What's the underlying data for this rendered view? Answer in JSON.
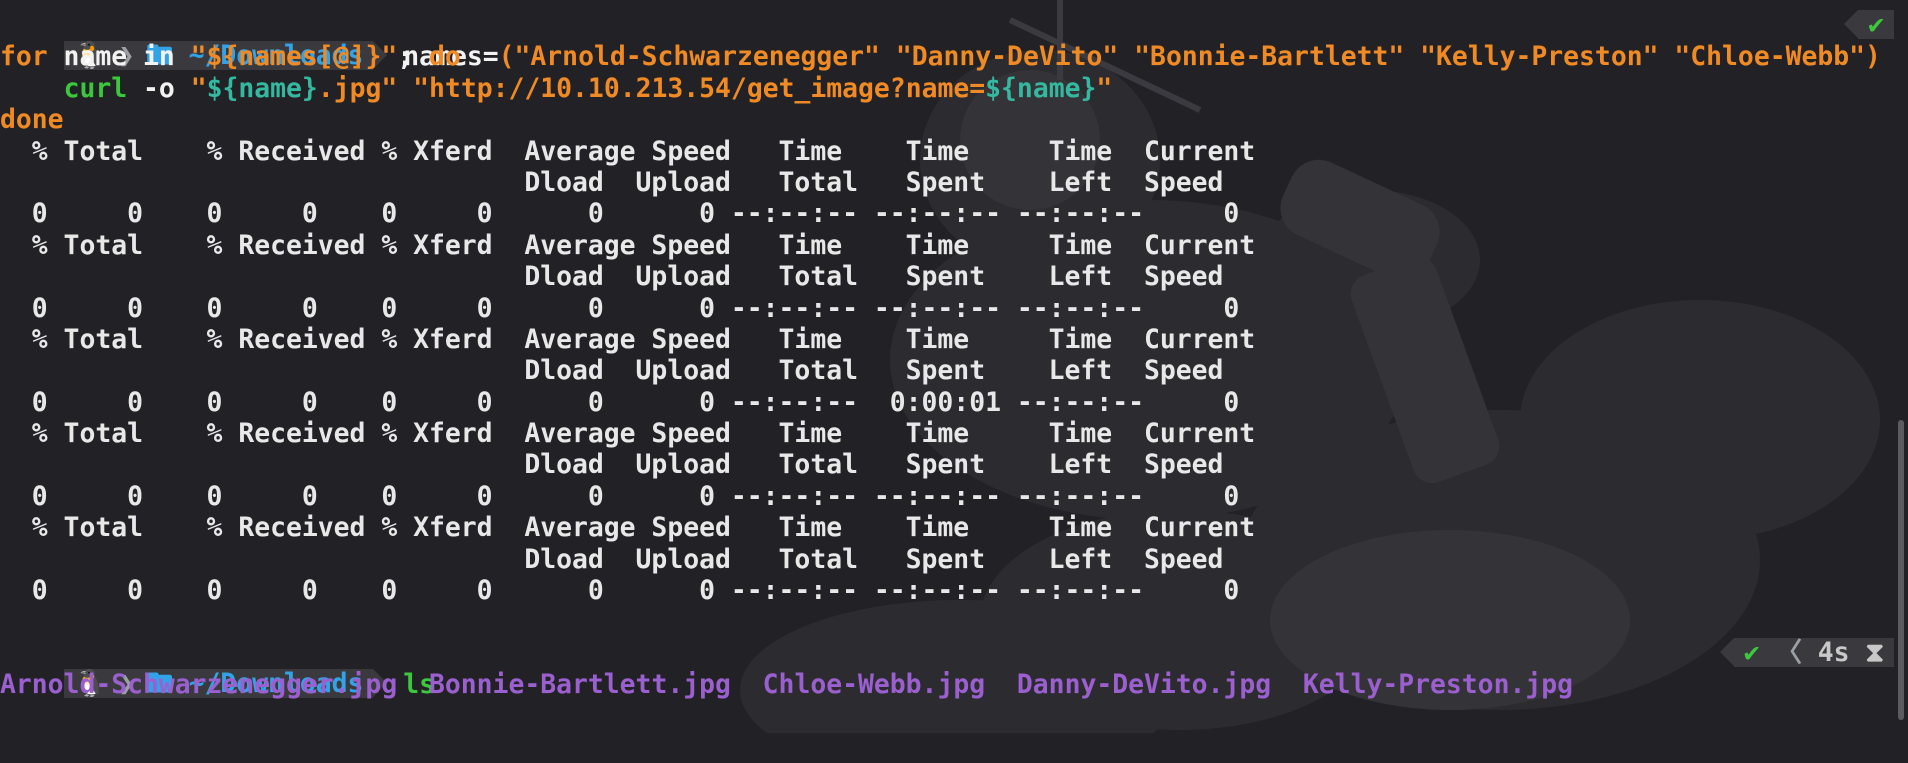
{
  "prompt1": {
    "os_icon": "linux-penguin-icon",
    "arrow_glyph": "❯",
    "folder_icon": "folder-icon",
    "folder_glyph": "🖿",
    "dir": "~/Downloads",
    "command_parts": {
      "p1": "names=",
      "p2": "(\"Arnold-Schwarzenegger\" \"Danny-DeVito\" \"Bonnie-Bartlett\" \"Kelly-Preston\" \"Chloe-Webb\")"
    },
    "status_ok": "✔"
  },
  "for_line": {
    "kw_for": "for",
    "mid": " name in ",
    "arr": "\"${names[@]}\"",
    "semi": "; ",
    "kw_do": "do"
  },
  "curl_line": {
    "indent": "    ",
    "cmd": "curl",
    "opt": " -o ",
    "q1": "\"",
    "var1": "${name}",
    "q1b": ".jpg\"",
    "sp": " ",
    "url": "\"http://10.10.213.54/get_image?name=",
    "var2": "${name}",
    "q2": "\""
  },
  "done_line": {
    "kw_done": "done"
  },
  "curl_output": [
    {
      "h1": "  % Total    % Received % Xferd  Average Speed   Time    Time     Time  Current",
      "h2": "                                 Dload  Upload   Total   Spent    Left  Speed",
      "r": "  0     0    0     0    0     0      0      0 --:--:-- --:--:-- --:--:--     0"
    },
    {
      "h1": "  % Total    % Received % Xferd  Average Speed   Time    Time     Time  Current",
      "h2": "                                 Dload  Upload   Total   Spent    Left  Speed",
      "r": "  0     0    0     0    0     0      0      0 --:--:-- --:--:-- --:--:--     0"
    },
    {
      "h1": "  % Total    % Received % Xferd  Average Speed   Time    Time     Time  Current",
      "h2": "                                 Dload  Upload   Total   Spent    Left  Speed",
      "r": "  0     0    0     0    0     0      0      0 --:--:--  0:00:01 --:--:--     0"
    },
    {
      "h1": "  % Total    % Received % Xferd  Average Speed   Time    Time     Time  Current",
      "h2": "                                 Dload  Upload   Total   Spent    Left  Speed",
      "r": "  0     0    0     0    0     0      0      0 --:--:-- --:--:-- --:--:--     0"
    },
    {
      "h1": "  % Total    % Received % Xferd  Average Speed   Time    Time     Time  Current",
      "h2": "                                 Dload  Upload   Total   Spent    Left  Speed",
      "r": "  0     0    0     0    0     0      0      0 --:--:-- --:--:-- --:--:--     0"
    }
  ],
  "prompt2": {
    "os_icon": "linux-penguin-icon",
    "arrow_glyph": "❯",
    "folder_icon": "folder-icon",
    "folder_glyph": "🖿",
    "dir": "~/Downloads",
    "command": "ls",
    "status_ok": "✔",
    "status_sep": "〈",
    "duration": "4s",
    "hourglass_glyph": "⧗"
  },
  "ls_output": [
    "Arnold-Schwarzenegger.jpg",
    "Bonnie-Bartlett.jpg",
    "Chloe-Webb.jpg",
    "Danny-DeVito.jpg",
    "Kelly-Preston.jpg"
  ],
  "colors": {
    "background": "#222226",
    "prompt_dir": "#33a3e8",
    "keyword": "#f08a24",
    "command_green": "#3cc83c",
    "variable": "#35b8a0",
    "file": "#9b5fd0"
  }
}
